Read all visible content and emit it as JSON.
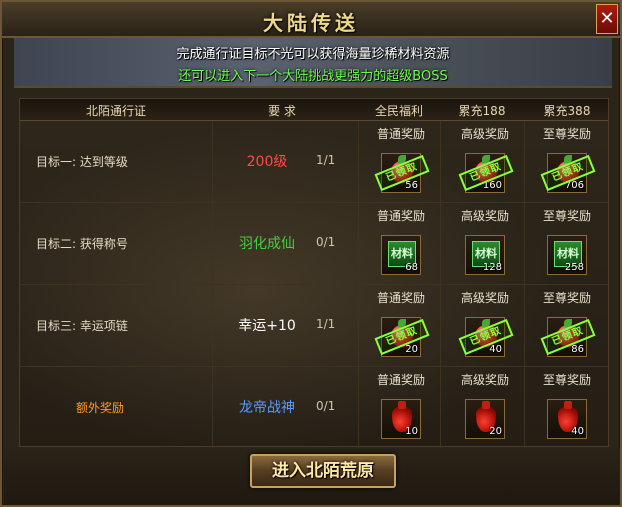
{
  "window": {
    "title": "大陆传送",
    "close_label": "✕"
  },
  "banner": {
    "line1": "完成通行证目标不光可以获得海量珍稀材料资源",
    "line2": "还可以进入下一个大陆挑战更强力的超级BOSS"
  },
  "table": {
    "headers": [
      "北陌通行证",
      "要  求",
      "全民福利",
      "累充188",
      "累充388"
    ],
    "tiers": [
      "普通奖励",
      "高级奖励",
      "至尊奖励"
    ],
    "claimed_stamp": "已领取",
    "rows": [
      {
        "goal": "目标一:  达到等级",
        "requirement": "200级",
        "requirement_color": "#ff4a4a",
        "progress": "1/1",
        "reward_icon": "gem-icon",
        "qty": [
          "56",
          "160",
          "706"
        ],
        "claimed": true
      },
      {
        "goal": "目标二:  获得称号",
        "requirement": "羽化成仙",
        "requirement_color": "#40d040",
        "progress": "0/1",
        "reward_icon": "material-icon",
        "material_label": "材料",
        "qty": [
          "68",
          "128",
          "258"
        ],
        "claimed": false
      },
      {
        "goal": "目标三:  幸运项链",
        "requirement": "幸运+10",
        "requirement_color": "#ffffff",
        "progress": "1/1",
        "reward_icon": "gem-icon",
        "qty": [
          "20",
          "40",
          "86"
        ],
        "claimed": true
      },
      {
        "goal": "额外奖励",
        "goal_color": "#ff9a2a",
        "requirement": "龙帝战神",
        "requirement_color": "#5a9aff",
        "progress": "0/1",
        "reward_icon": "potion-icon",
        "qty": [
          "10",
          "20",
          "40"
        ],
        "claimed": false
      }
    ]
  },
  "enter_button": {
    "label": "进入北陌荒原"
  }
}
